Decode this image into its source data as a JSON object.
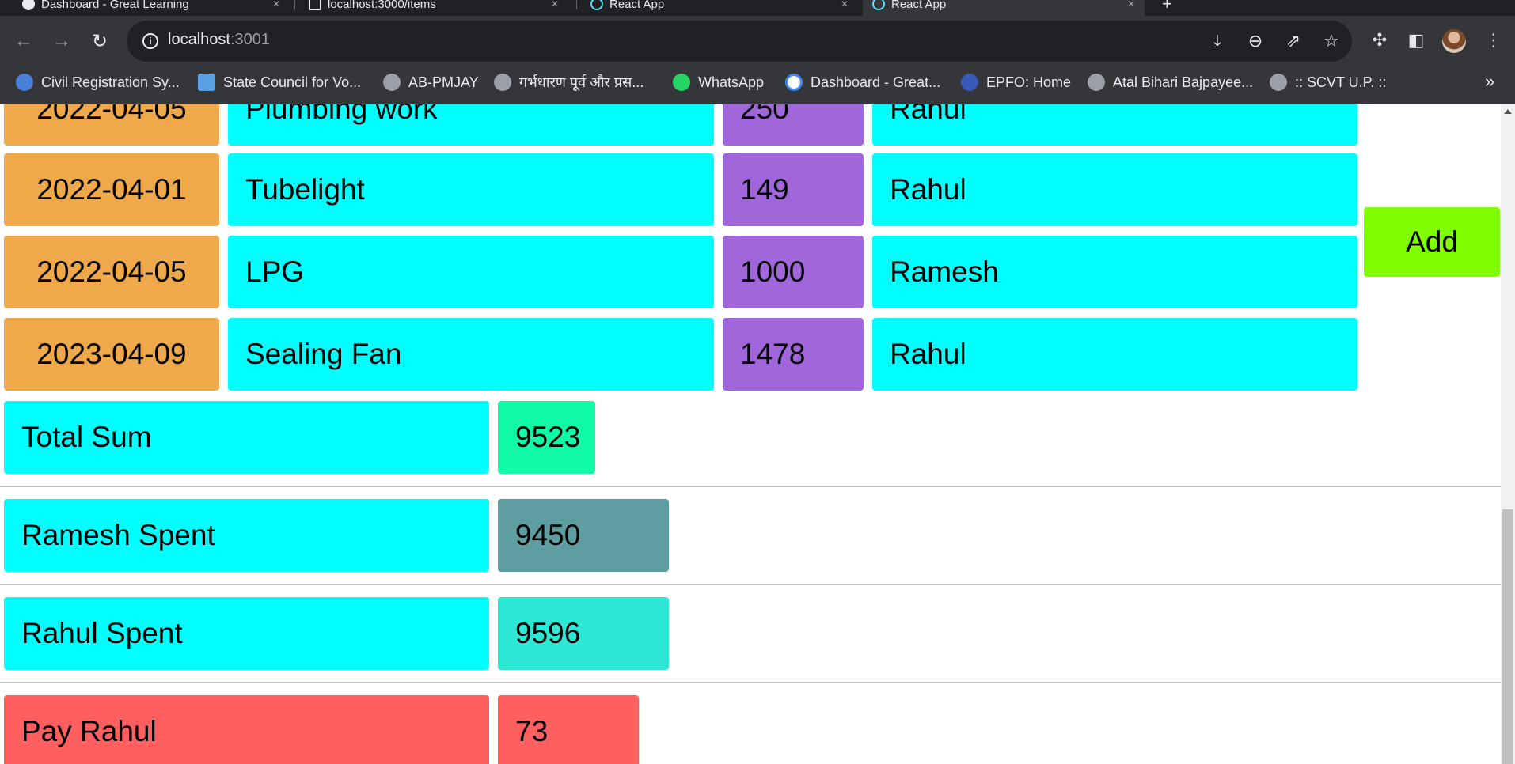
{
  "browser": {
    "tabs": [
      {
        "title": "Dashboard - Great Learning",
        "active": false
      },
      {
        "title": "localhost:3000/items",
        "active": false
      },
      {
        "title": "React App",
        "active": false
      },
      {
        "title": "React App",
        "active": true
      }
    ],
    "new_tab_label": "+",
    "url_host": "localhost",
    "url_port": ":3001",
    "bookmarks": [
      {
        "label": "Civil Registration Sy...",
        "icon": "globe-blue-icon",
        "color": "#4a7fd8"
      },
      {
        "label": "State Council for Vo...",
        "icon": "council-icon",
        "color": "#5aa0e0"
      },
      {
        "label": "AB-PMJAY",
        "icon": "globe-icon",
        "color": "#9aa0a6"
      },
      {
        "label": "गर्भधारण पूर्व और प्रस...",
        "icon": "globe-icon",
        "color": "#9aa0a6"
      },
      {
        "label": "WhatsApp",
        "icon": "whatsapp-icon",
        "color": "#25d366"
      },
      {
        "label": "Dashboard - Great...",
        "icon": "google-icon",
        "color": "#ffffff"
      },
      {
        "label": "EPFO: Home",
        "icon": "epfo-icon",
        "color": "#3a5ab8"
      },
      {
        "label": "Atal Bihari Bajpayee...",
        "icon": "globe-icon",
        "color": "#9aa0a6"
      },
      {
        "label": ":: SCVT U.P. ::",
        "icon": "globe-icon",
        "color": "#9aa0a6"
      }
    ],
    "bookmarks_overflow": "»"
  },
  "expenses": [
    {
      "date": "2022-04-05",
      "description": "Plumbing work",
      "amount": "250",
      "person": "Rahul"
    },
    {
      "date": "2022-04-01",
      "description": "Tubelight",
      "amount": "149",
      "person": "Rahul"
    },
    {
      "date": "2022-04-05",
      "description": "LPG",
      "amount": "1000",
      "person": "Ramesh"
    },
    {
      "date": "2023-04-09",
      "description": "Sealing Fan",
      "amount": "1478",
      "person": "Rahul"
    }
  ],
  "add_button_label": "Add",
  "summary": {
    "total": {
      "label": "Total Sum",
      "value": "9523"
    },
    "ramesh": {
      "label": "Ramesh Spent",
      "value": "9450"
    },
    "rahul": {
      "label": "Rahul Spent",
      "value": "9596"
    },
    "pay": {
      "label": "Pay Rahul",
      "value": "73"
    }
  },
  "colors": {
    "date_cell": "#efa94a",
    "text_cell": "#00ffff",
    "amount_cell": "#a066da",
    "total_value": "#11faa6",
    "ramesh_value": "#5f9ea0",
    "rahul_value": "#2ee8d6",
    "pay_cell": "#ff5f5f",
    "add_button": "#7fff00"
  }
}
